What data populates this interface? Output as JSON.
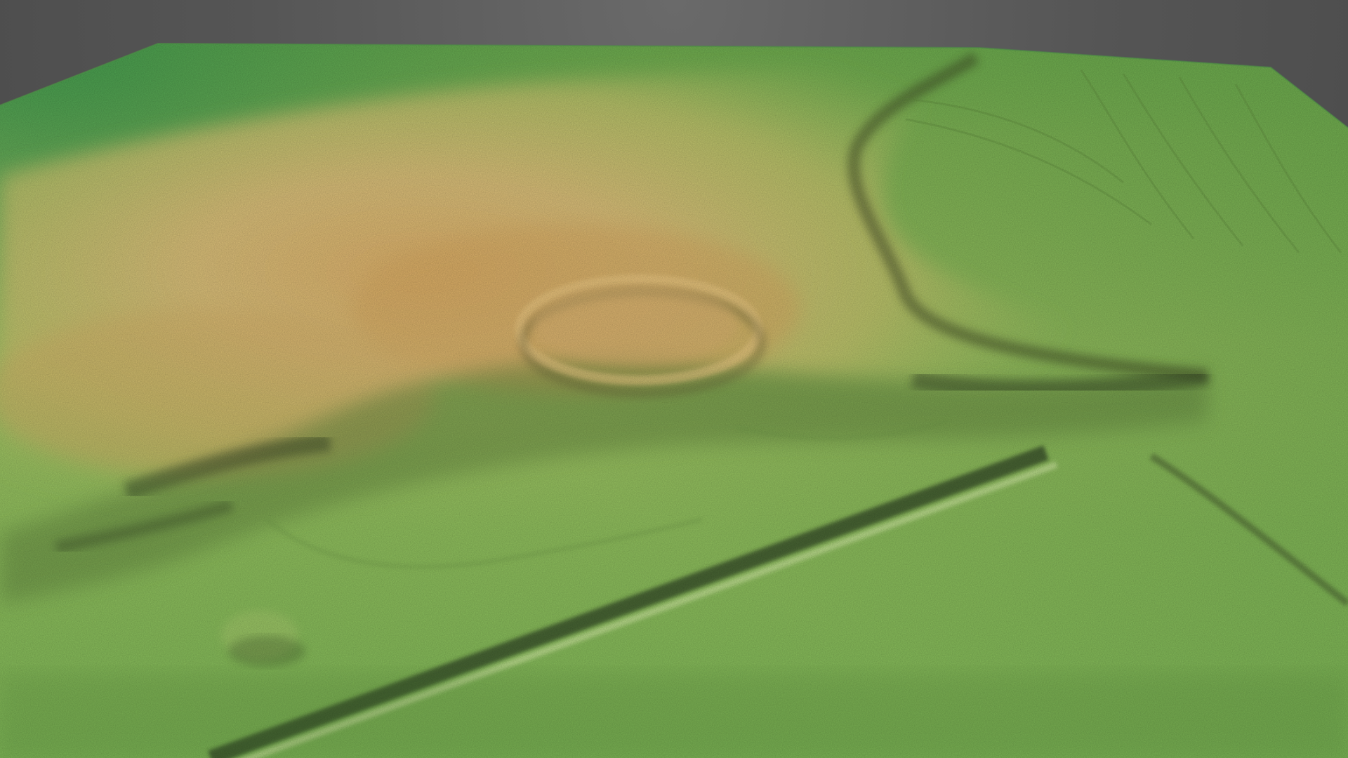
{
  "scene": {
    "subject": "lidar-terrain-elevation-model",
    "palette": {
      "background": "#545454",
      "low_green": "#6fb24a",
      "mid_green": "#9cc45f",
      "high_yellow": "#d9c27a",
      "peak_tan": "#d6a861",
      "shadow": "#2f3e22"
    }
  }
}
